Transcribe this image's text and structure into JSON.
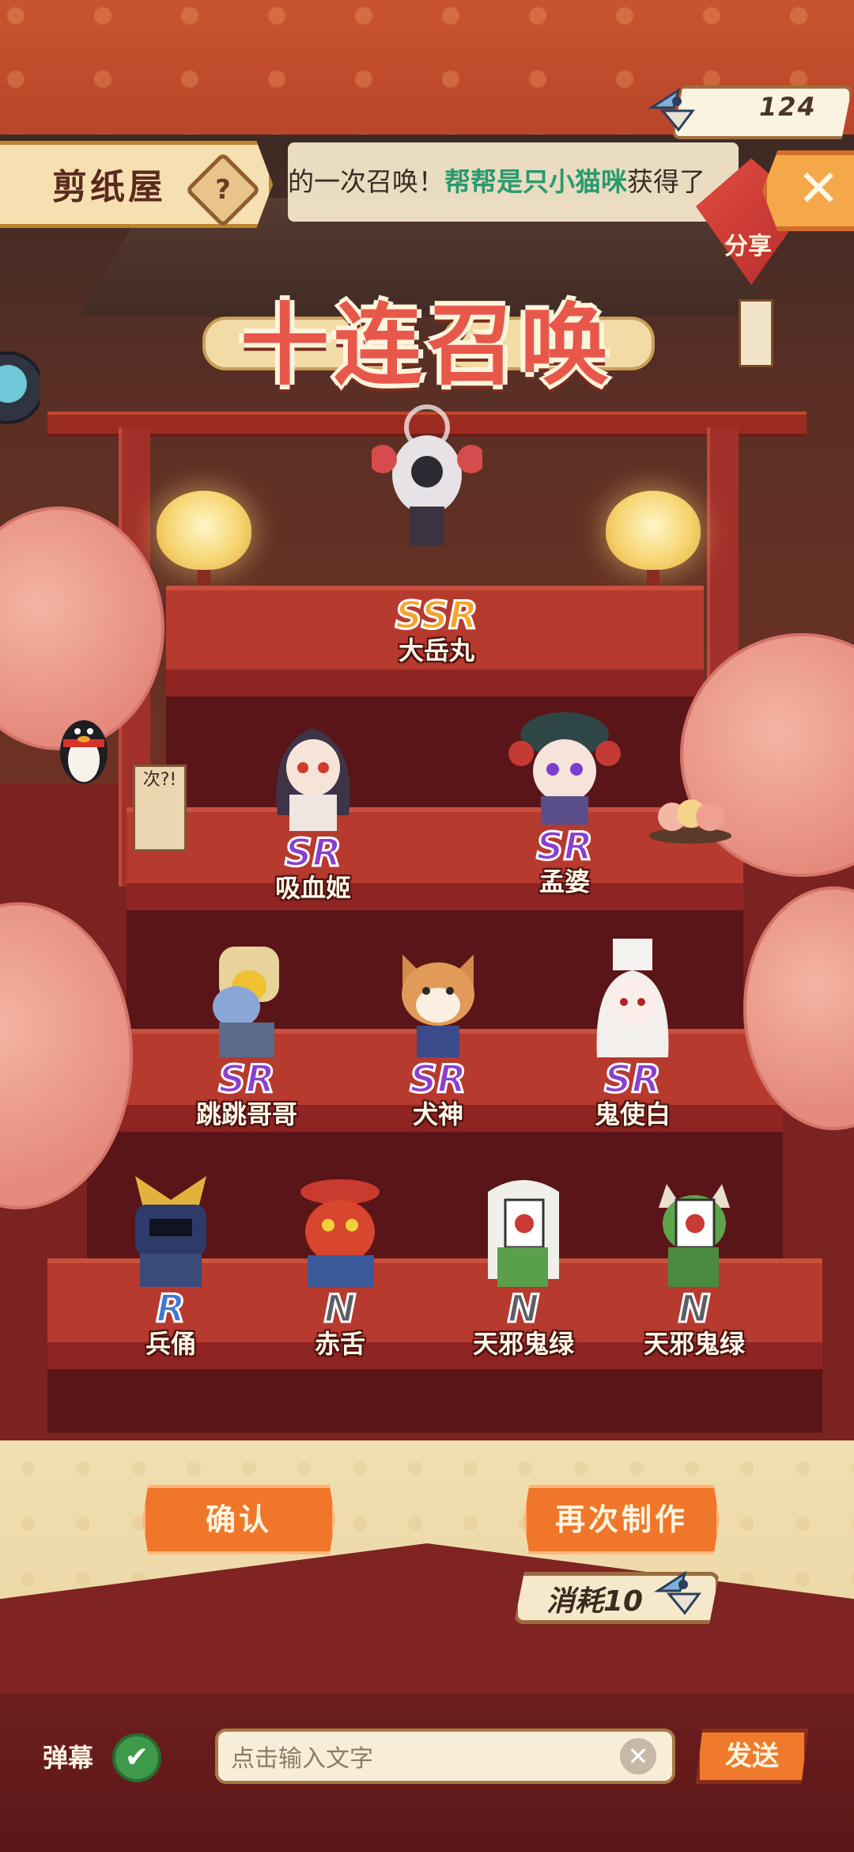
{
  "header": {
    "title": "剪纸屋",
    "help_icon": "?",
    "marquee_prefix": "的一次召唤！",
    "marquee_highlight": "帮帮是只小猫咪",
    "marquee_suffix": "获得了",
    "close_icon": "✕",
    "share_label": "分享"
  },
  "currency": {
    "value": "124",
    "icon": "paper-bird-icon"
  },
  "banner": {
    "title": "十连召唤"
  },
  "results": [
    {
      "rarity": "SSR",
      "name": "大岳丸"
    },
    {
      "rarity": "SR",
      "name": "吸血姬"
    },
    {
      "rarity": "SR",
      "name": "孟婆"
    },
    {
      "rarity": "SR",
      "name": "跳跳哥哥"
    },
    {
      "rarity": "SR",
      "name": "犬神"
    },
    {
      "rarity": "SR",
      "name": "鬼使白"
    },
    {
      "rarity": "R",
      "name": "兵俑"
    },
    {
      "rarity": "N",
      "name": "赤舌"
    },
    {
      "rarity": "N",
      "name": "天邪鬼绿"
    },
    {
      "rarity": "N",
      "name": "天邪鬼绿"
    }
  ],
  "actions": {
    "confirm_label": "确认",
    "again_label": "再次制作",
    "cost_label": "消耗10"
  },
  "danmaku": {
    "label": "弹幕",
    "check_icon": "✔",
    "placeholder": "点击输入文字",
    "clear_icon": "✕",
    "send_label": "发送"
  },
  "sign": {
    "text": "次?!"
  },
  "colors": {
    "ssr": "#f3a42a",
    "sr": "#8a3fd0",
    "r": "#3b7ad6",
    "n": "#5a5e66",
    "accent": "#f0772a"
  }
}
